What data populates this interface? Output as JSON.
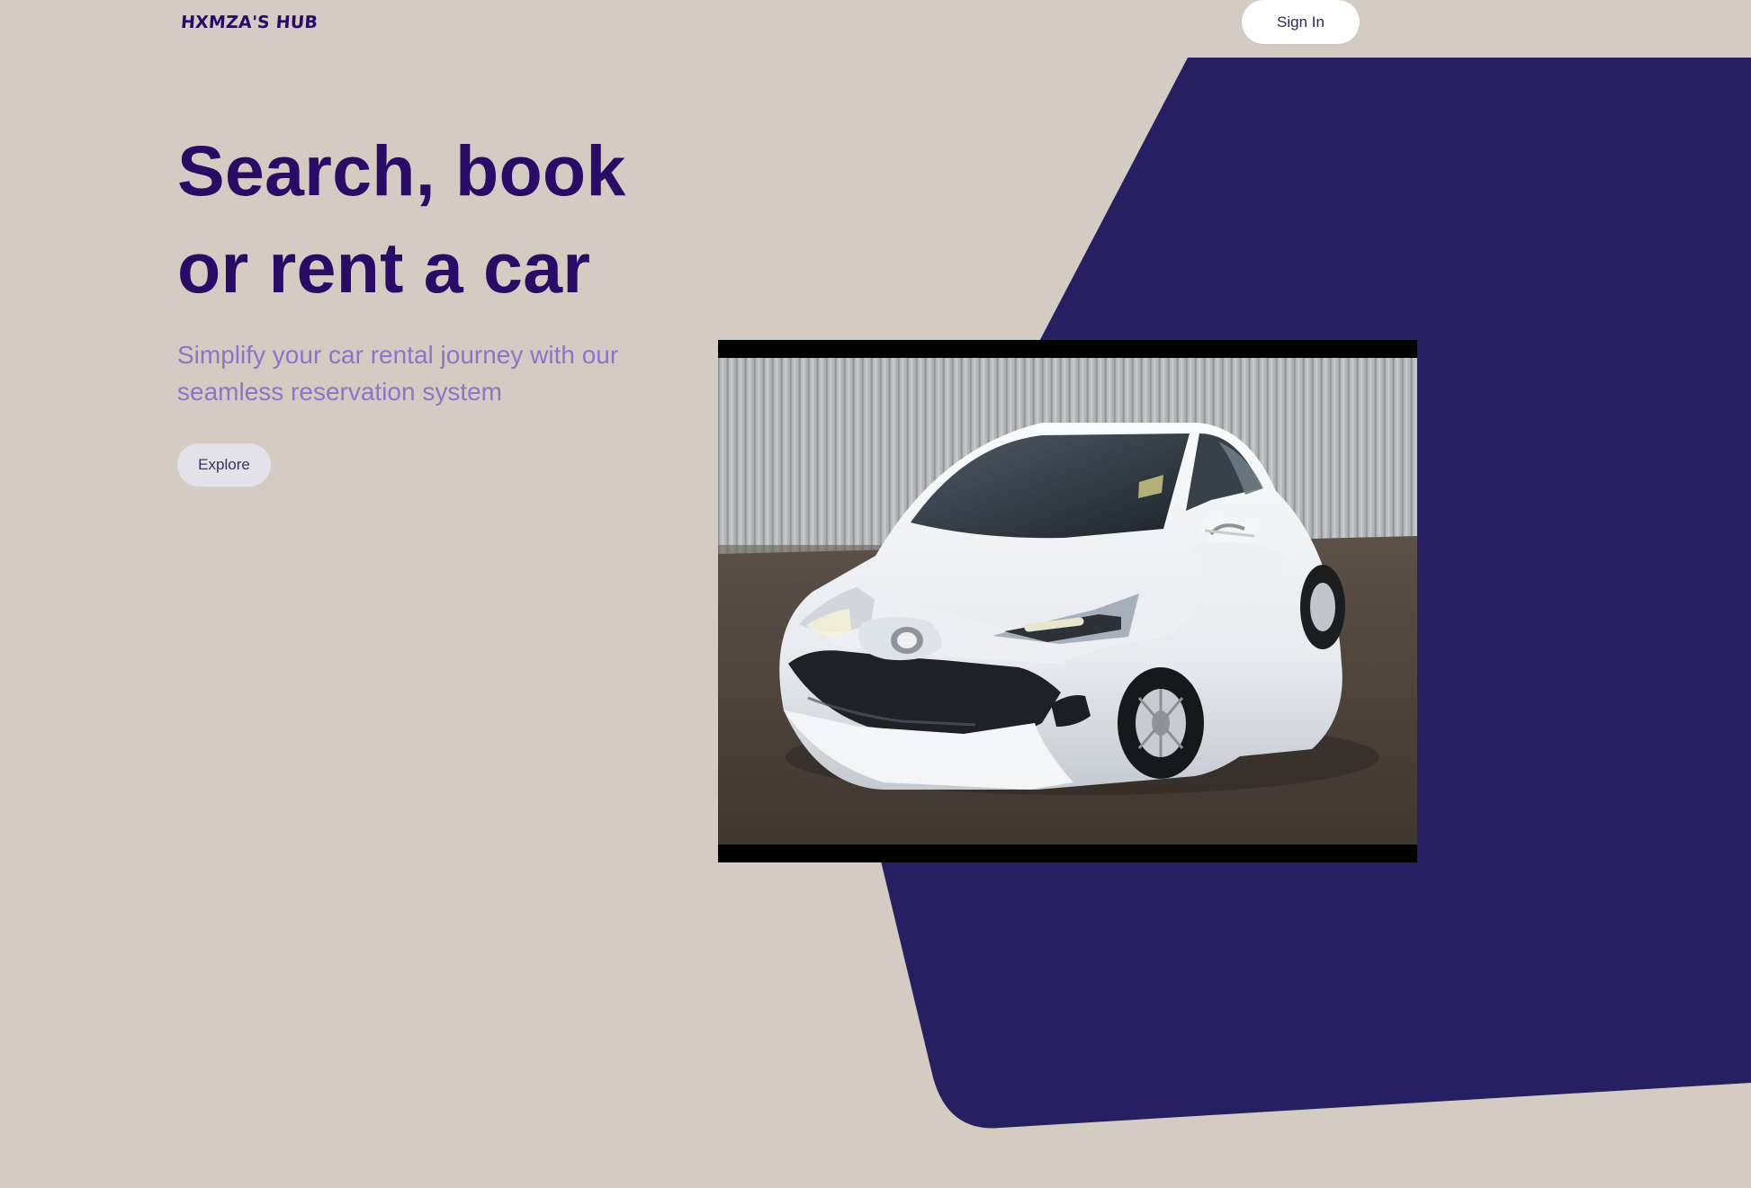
{
  "nav": {
    "brand": "HXMZA'S HUB",
    "sign_in": "Sign In"
  },
  "hero": {
    "title_line_1": "Search, book",
    "title_line_2": "or rent a car",
    "subtitle": "Simplify your car rental journey with our seamless reservation system",
    "explore": "Explore"
  },
  "colors": {
    "background": "#d4ccc2",
    "accent_navy": "#262063",
    "heading": "#2a0b66",
    "subtitle": "#8f73c8"
  },
  "media": {
    "image_subject": "white hatchback car"
  }
}
